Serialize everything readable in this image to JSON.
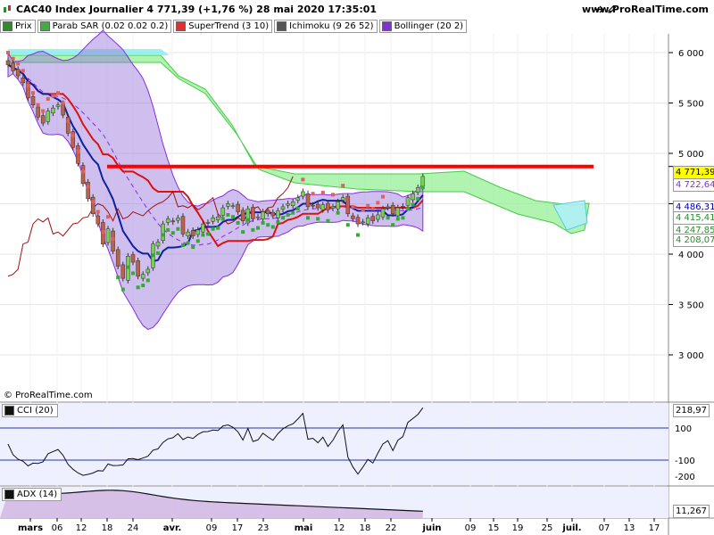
{
  "header": {
    "title": "CAC40 Index Journalier 4 771,39 (+1,76 %) 28 mai 2020 17:35:01",
    "site": "www.ProRealTime.com",
    "copyright": "© ProRealTime.com"
  },
  "legend": [
    {
      "label": "Prix",
      "color": "#2e8b2e"
    },
    {
      "label": "Parab SAR (0.02 0.02 0.2)",
      "color": "#44aa44"
    },
    {
      "label": "SuperTrend (3 10)",
      "color": "#e03030"
    },
    {
      "label": "Ichimoku (9 26 52)",
      "color": "#555555"
    },
    {
      "label": "Bollinger (20 2)",
      "color": "#8a2be2"
    }
  ],
  "price_tags": [
    {
      "value": "4 771,39",
      "bg": "#ffff00",
      "fg": "#000000"
    },
    {
      "value": "4 722,64",
      "bg": "#ffffff",
      "fg": "#8a2be2"
    },
    {
      "value": "4 486,31",
      "bg": "#ffffff",
      "fg": "#0000aa"
    },
    {
      "value": "4 415,41",
      "bg": "#ffffff",
      "fg": "#2e8b2e"
    },
    {
      "value": "4 247,85",
      "bg": "#ffffff",
      "fg": "#2e8b2e"
    },
    {
      "value": "4 208,07",
      "bg": "#ffffff",
      "fg": "#2e8b2e"
    }
  ],
  "cci": {
    "label": "CCI (20)",
    "value": "218,97",
    "ticks": [
      "100",
      "-100",
      "-200"
    ]
  },
  "adx": {
    "label": "ADX (14)",
    "value": "11,267"
  },
  "chart_data": {
    "type": "candlestick",
    "title": "CAC40 Index Journalier",
    "ylim": [
      2700,
      6300
    ],
    "yticks": [
      3000,
      3500,
      4000,
      4500,
      5000,
      5500,
      6000
    ],
    "ytick_labels": [
      "3 000",
      "3 500",
      "4 000",
      "4 500",
      "5 000",
      "5 500",
      "6 000"
    ],
    "xtick_labels": [
      "mars",
      "06",
      "12",
      "18",
      "24",
      "avr.",
      "09",
      "17",
      "23",
      "mai",
      "12",
      "18",
      "22",
      "juin",
      "09",
      "15",
      "19",
      "25",
      "juil.",
      "07",
      "13",
      "17"
    ],
    "horizontal_line": 4870,
    "close": [
      5880,
      5820,
      5770,
      5700,
      5550,
      5480,
      5360,
      5300,
      5420,
      5450,
      5480,
      5380,
      5200,
      5060,
      4900,
      4700,
      4550,
      4400,
      4300,
      4100,
      4250,
      4030,
      3880,
      3760,
      3980,
      3920,
      3780,
      3800,
      3850,
      4100,
      4120,
      4300,
      4350,
      4320,
      4360,
      4200,
      4220,
      4180,
      4240,
      4300,
      4310,
      4360,
      4370,
      4460,
      4500,
      4480,
      4420,
      4330,
      4450,
      4350,
      4370,
      4420,
      4400,
      4380,
      4430,
      4470,
      4500,
      4520,
      4560,
      4620,
      4470,
      4480,
      4460,
      4490,
      4440,
      4470,
      4520,
      4560,
      4400,
      4350,
      4300,
      4320,
      4360,
      4330,
      4390,
      4450,
      4470,
      4400,
      4460,
      4470,
      4560,
      4600,
      4660,
      4771
    ]
  }
}
